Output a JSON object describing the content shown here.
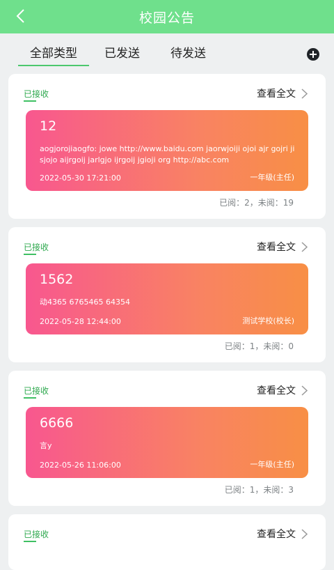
{
  "header": {
    "title": "校园公告"
  },
  "tabs": [
    {
      "label": "全部类型"
    },
    {
      "label": "已发送"
    },
    {
      "label": "待发送"
    }
  ],
  "view_label": "查看全文",
  "colors": {
    "accent": "#6fe08c",
    "status_green": "#2ea84e"
  },
  "notices": [
    {
      "status": "已接收",
      "title": "12",
      "content": "aogjorojiaogfo: jowe http://www.baidu.com jaorwjoiji ojoi ajr gojri jisjojo aijrgoij jarlgjo ijrgoij jgioji org http://abc.com",
      "datetime": "2022-05-30 17:21:00",
      "sender": "一年级(主任)",
      "read_stats": "已阅：2，未阅：19"
    },
    {
      "status": "已接收",
      "title": "1562",
      "content": "动4365 6765465 64354",
      "datetime": "2022-05-28 12:44:00",
      "sender": "测试学校(校长)",
      "read_stats": "已阅：1，未阅：0"
    },
    {
      "status": "已接收",
      "title": "6666",
      "content": "言y",
      "datetime": "2022-05-26 11:06:00",
      "sender": "一年级(主任)",
      "read_stats": "已阅：1，未阅：3"
    },
    {
      "status": "已接收"
    }
  ]
}
